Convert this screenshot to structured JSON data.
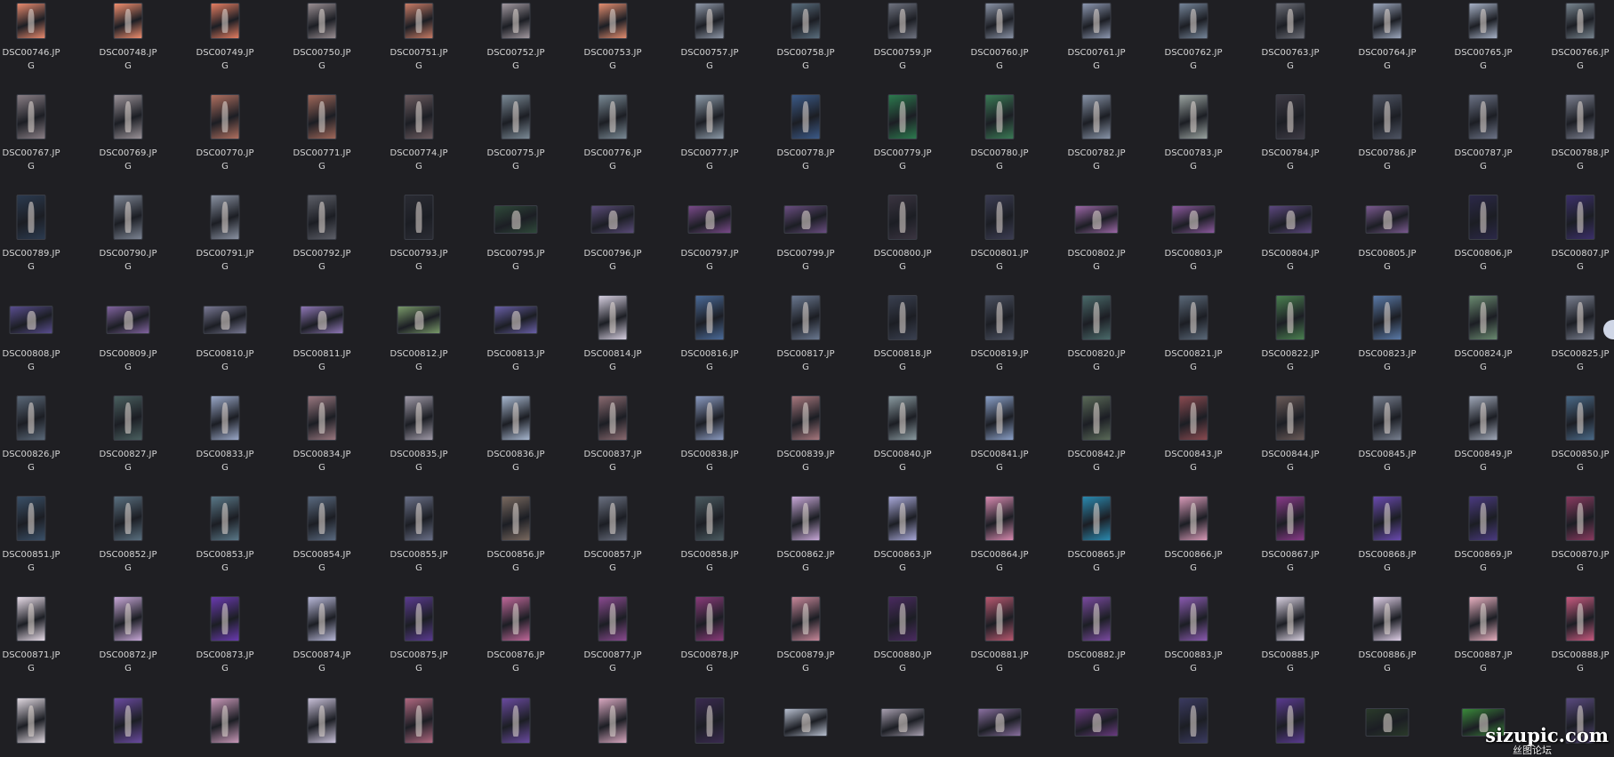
{
  "window": {
    "background": "#1f1f23",
    "text_color": "#d6d6d6"
  },
  "files": [
    [
      "DSC00746.JPG",
      "DSC00748.JPG",
      "DSC00749.JPG",
      "DSC00750.JPG",
      "DSC00751.JPG",
      "DSC00752.JPG",
      "DSC00753.JPG",
      "DSC00757.JPG",
      "DSC00758.JPG",
      "DSC00759.JPG",
      "DSC00760.JPG",
      "DSC00761.JPG",
      "DSC00762.JPG",
      "DSC00763.JPG",
      "DSC00764.JPG",
      "DSC00765.JPG",
      "DSC00766.JPG"
    ],
    [
      "DSC00767.JPG",
      "DSC00769.JPG",
      "DSC00770.JPG",
      "DSC00771.JPG",
      "DSC00774.JPG",
      "DSC00775.JPG",
      "DSC00776.JPG",
      "DSC00777.JPG",
      "DSC00778.JPG",
      "DSC00779.JPG",
      "DSC00780.JPG",
      "DSC00782.JPG",
      "DSC00783.JPG",
      "DSC00784.JPG",
      "DSC00786.JPG",
      "DSC00787.JPG",
      "DSC00788.JPG"
    ],
    [
      "DSC00789.JPG",
      "DSC00790.JPG",
      "DSC00791.JPG",
      "DSC00792.JPG",
      "DSC00793.JPG",
      "DSC00795.JPG",
      "DSC00796.JPG",
      "DSC00797.JPG",
      "DSC00799.JPG",
      "DSC00800.JPG",
      "DSC00801.JPG",
      "DSC00802.JPG",
      "DSC00803.JPG",
      "DSC00804.JPG",
      "DSC00805.JPG",
      "DSC00806.JPG",
      "DSC00807.JPG"
    ],
    [
      "DSC00808.JPG",
      "DSC00809.JPG",
      "DSC00810.JPG",
      "DSC00811.JPG",
      "DSC00812.JPG",
      "DSC00813.JPG",
      "DSC00814.JPG",
      "DSC00816.JPG",
      "DSC00817.JPG",
      "DSC00818.JPG",
      "DSC00819.JPG",
      "DSC00820.JPG",
      "DSC00821.JPG",
      "DSC00822.JPG",
      "DSC00823.JPG",
      "DSC00824.JPG",
      "DSC00825.JPG"
    ],
    [
      "DSC00826.JPG",
      "DSC00827.JPG",
      "DSC00833.JPG",
      "DSC00834.JPG",
      "DSC00835.JPG",
      "DSC00836.JPG",
      "DSC00837.JPG",
      "DSC00838.JPG",
      "DSC00839.JPG",
      "DSC00840.JPG",
      "DSC00841.JPG",
      "DSC00842.JPG",
      "DSC00843.JPG",
      "DSC00844.JPG",
      "DSC00845.JPG",
      "DSC00849.JPG",
      "DSC00850.JPG"
    ],
    [
      "DSC00851.JPG",
      "DSC00852.JPG",
      "DSC00853.JPG",
      "DSC00854.JPG",
      "DSC00855.JPG",
      "DSC00856.JPG",
      "DSC00857.JPG",
      "DSC00858.JPG",
      "DSC00862.JPG",
      "DSC00863.JPG",
      "DSC00864.JPG",
      "DSC00865.JPG",
      "DSC00866.JPG",
      "DSC00867.JPG",
      "DSC00868.JPG",
      "DSC00869.JPG",
      "DSC00870.JPG"
    ],
    [
      "DSC00871.JPG",
      "DSC00872.JPG",
      "DSC00873.JPG",
      "DSC00874.JPG",
      "DSC00875.JPG",
      "DSC00876.JPG",
      "DSC00877.JPG",
      "DSC00878.JPG",
      "DSC00879.JPG",
      "DSC00880.JPG",
      "DSC00881.JPG",
      "DSC00882.JPG",
      "DSC00883.JPG",
      "DSC00885.JPG",
      "DSC00886.JPG",
      "DSC00887.JPG",
      "DSC00888.JPG"
    ],
    [
      "",
      "",
      "",
      "",
      "",
      "",
      "",
      "",
      "",
      "",
      "",
      "",
      "",
      "",
      "",
      "",
      ""
    ]
  ],
  "orientations": [
    [
      "p",
      "p",
      "p",
      "p",
      "p",
      "p",
      "p",
      "p",
      "p",
      "p",
      "p",
      "p",
      "p",
      "p",
      "p",
      "p",
      "p"
    ],
    [
      "p",
      "p",
      "p",
      "p",
      "p",
      "p",
      "p",
      "p",
      "p",
      "p",
      "p",
      "p",
      "p",
      "p",
      "p",
      "p",
      "p"
    ],
    [
      "p",
      "p",
      "p",
      "p",
      "p",
      "l",
      "l",
      "l",
      "l",
      "p",
      "p",
      "l",
      "l",
      "l",
      "l",
      "p",
      "p"
    ],
    [
      "l",
      "l",
      "l",
      "l",
      "l",
      "l",
      "p",
      "p",
      "p",
      "p",
      "p",
      "p",
      "p",
      "p",
      "p",
      "p",
      "p"
    ],
    [
      "p",
      "p",
      "p",
      "p",
      "p",
      "p",
      "p",
      "p",
      "p",
      "p",
      "p",
      "p",
      "p",
      "p",
      "p",
      "p",
      "p"
    ],
    [
      "p",
      "p",
      "p",
      "p",
      "p",
      "p",
      "p",
      "p",
      "p",
      "p",
      "p",
      "p",
      "p",
      "p",
      "p",
      "p",
      "p"
    ],
    [
      "p",
      "p",
      "p",
      "p",
      "p",
      "p",
      "p",
      "p",
      "p",
      "p",
      "p",
      "p",
      "p",
      "p",
      "p",
      "p",
      "p"
    ],
    [
      "p",
      "p",
      "p",
      "p",
      "p",
      "p",
      "p",
      "p",
      "l",
      "l",
      "l",
      "l",
      "p",
      "p",
      "l",
      "l",
      "p"
    ]
  ],
  "thumb_palettes": [
    [
      "#e98a6e",
      "#f28f6f",
      "#e67e62",
      "#9a8f93",
      "#c97c66",
      "#a39aa1",
      "#e58e70",
      "#8f98a8",
      "#5a6e7e",
      "#6f7380",
      "#8a93a6",
      "#8d98b1",
      "#758599",
      "#6b6d76",
      "#9ea9bf",
      "#a7b2c7",
      "#78858f"
    ],
    [
      "#8a7f86",
      "#9b9399",
      "#b07060",
      "#a0685a",
      "#6d5c60",
      "#7b8a96",
      "#7a8a95",
      "#8c9aa8",
      "#3b5a88",
      "#2c7a4e",
      "#3a7a55",
      "#8894a8",
      "#9aa3a0",
      "#3d3a44",
      "#4e5463",
      "#6c7386",
      "#7c8090"
    ],
    [
      "#2b3a4f",
      "#7d8594",
      "#8a92a2",
      "#5d5f68",
      "#2a2b33",
      "#2f4a3a",
      "#5b4c7a",
      "#7a4a8a",
      "#6b4e82",
      "#3a3440",
      "#3b3c52",
      "#9d68a8",
      "#8e5aa0",
      "#5d4880",
      "#7b5a90",
      "#2b2848",
      "#3b2f6a"
    ],
    [
      "#5a4e90",
      "#8264a0",
      "#7a7a95",
      "#9078b8",
      "#7a9a6a",
      "#6a60a8",
      "#d6cfe0",
      "#4a6a98",
      "#6a7890",
      "#3a4050",
      "#4a5060",
      "#4a6a6a",
      "#5a6878",
      "#4a8050",
      "#5a7aa8",
      "#6a8a70",
      "#7a8090"
    ],
    [
      "#5a6878",
      "#4a6060",
      "#9aa8c8",
      "#9a7880",
      "#a09aa8",
      "#a8b8d0",
      "#8a6a70",
      "#8a9ac0",
      "#a8787e",
      "#8a9aa0",
      "#8aa0c8",
      "#5a6a58",
      "#8a4a50",
      "#6a5a58",
      "#788090",
      "#a0a8b8",
      "#4a6a88"
    ],
    [
      "#3a5068",
      "#5a7080",
      "#5a7888",
      "#5a6a80",
      "#6a7088",
      "#7a6a60",
      "#6a7080",
      "#4a5a60",
      "#c8a8d8",
      "#a8a8d8",
      "#d88ab0",
      "#2a8ab0",
      "#d89ab8",
      "#8a3a8a",
      "#6a4ab0",
      "#4a3a80",
      "#8a3a60"
    ],
    [
      "#e8dce8",
      "#c8a8d8",
      "#6a3ab0",
      "#b8b8d8",
      "#5a3a90",
      "#c0689a",
      "#8a4a90",
      "#8a3a7a",
      "#c8889a",
      "#4a2a60",
      "#b85870",
      "#7a4aa0",
      "#8a5ab0",
      "#d8d0e0",
      "#e0d0e8",
      "#e8b0c0",
      "#c85a80"
    ],
    [
      "#e0d8e0",
      "#6a4aa0",
      "#c898b8",
      "#c8c0d8",
      "#b06880",
      "#6a4aa0",
      "#d8a8c0",
      "#3a2a50",
      "#b8c0d0",
      "#a8a0b0",
      "#8a70a0",
      "#6a3a80",
      "#3a3a60",
      "#5a3a90",
      "#2a3a2a",
      "#3a8a3a",
      "#5a4a80"
    ]
  ],
  "watermark": {
    "text": "sizupic.com",
    "sub": "丝图论坛"
  }
}
